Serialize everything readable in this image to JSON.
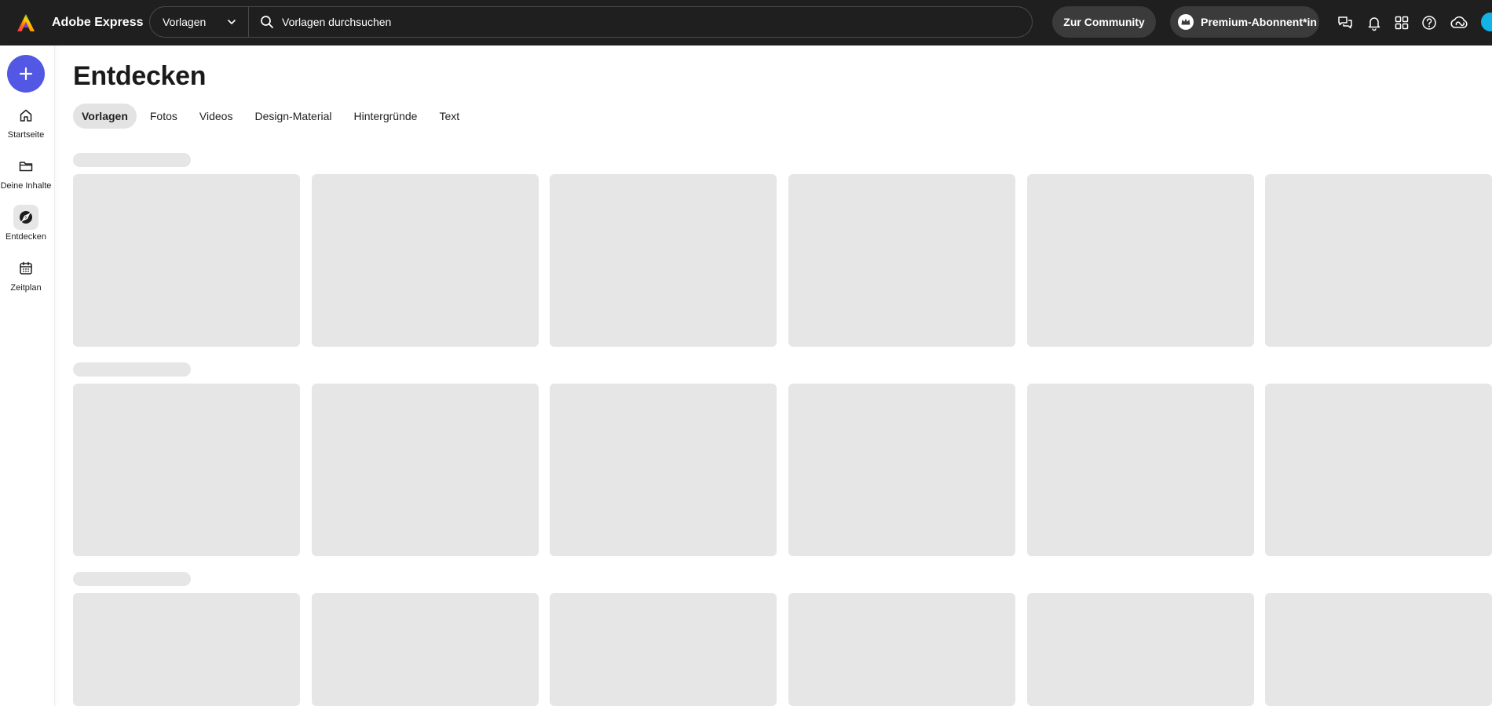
{
  "app": {
    "name": "Adobe Express"
  },
  "search": {
    "scope_label": "Vorlagen",
    "placeholder": "Vorlagen durchsuchen"
  },
  "header": {
    "community_label": "Zur Community",
    "premium_label": "Premium-Abonnent*in",
    "icons": [
      "chat-icon",
      "bell-icon",
      "apps-grid-icon",
      "help-icon",
      "creative-cloud-icon"
    ]
  },
  "rail": {
    "create_icon": "plus-icon",
    "items": [
      {
        "label": "Startseite",
        "icon": "home-icon",
        "active": false
      },
      {
        "label": "Deine Inhalte",
        "icon": "folder-icon",
        "active": false
      },
      {
        "label": "Entdecken",
        "icon": "compass-icon",
        "active": true
      },
      {
        "label": "Zeitplan",
        "icon": "calendar-icon",
        "active": false
      }
    ]
  },
  "main": {
    "title": "Entdecken",
    "tabs": [
      {
        "label": "Vorlagen",
        "active": true
      },
      {
        "label": "Fotos",
        "active": false
      },
      {
        "label": "Videos",
        "active": false
      },
      {
        "label": "Design-Material",
        "active": false
      },
      {
        "label": "Hintergründe",
        "active": false
      },
      {
        "label": "Text",
        "active": false
      }
    ]
  },
  "colors": {
    "topbar": "#1f1f1f",
    "accent": "#5258e4",
    "skeleton": "#e6e6e6",
    "avatar": "#12b3e6"
  }
}
